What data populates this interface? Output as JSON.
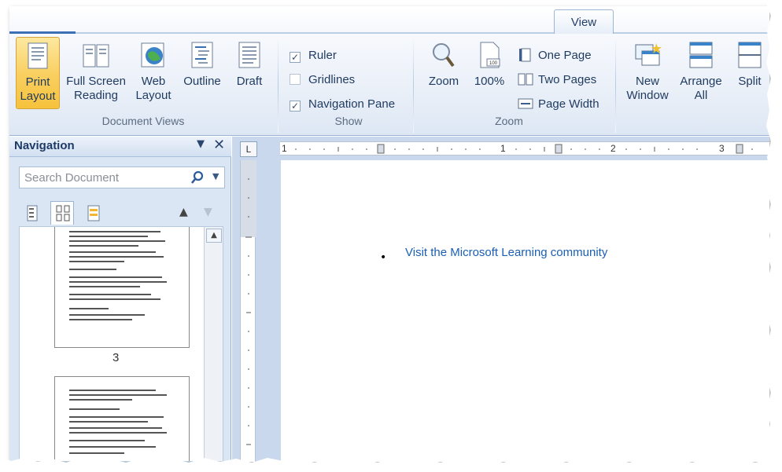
{
  "ribbon": {
    "active_tab": "View",
    "document_views": {
      "label": "Document Views",
      "buttons": [
        {
          "label": "Print\nLayout",
          "line1": "Print",
          "line2": "Layout",
          "active": true
        },
        {
          "label": "Full Screen Reading",
          "line1": "Full Screen",
          "line2": "Reading"
        },
        {
          "label": "Web Layout",
          "line1": "Web",
          "line2": "Layout"
        },
        {
          "label": "Outline",
          "line1": "Outline",
          "line2": ""
        },
        {
          "label": "Draft",
          "line1": "Draft",
          "line2": ""
        }
      ]
    },
    "show": {
      "label": "Show",
      "items": [
        {
          "label": "Ruler",
          "checked": true
        },
        {
          "label": "Gridlines",
          "checked": false
        },
        {
          "label": "Navigation Pane",
          "checked": true
        }
      ]
    },
    "zoom": {
      "label": "Zoom",
      "zoom_button": "Zoom",
      "hundred_button": "100%",
      "one_page": "One Page",
      "two_pages": "Two Pages",
      "page_width": "Page Width"
    },
    "window": {
      "new_window_line1": "New",
      "new_window_line2": "Window",
      "arrange_all_line1": "Arrange",
      "arrange_all_line2": "All",
      "split": "Split"
    }
  },
  "navigation": {
    "title": "Navigation",
    "search_placeholder": "Search Document",
    "current_thumb_page": "3"
  },
  "ruler": {
    "tab_selector": "L",
    "marks": [
      "1",
      "1",
      "2",
      "3"
    ]
  },
  "document": {
    "link_text": "Visit the Microsoft Learning community",
    "bullet": "•"
  },
  "colors": {
    "ribbon_bg": "#e9eff8",
    "active_button": "#f9d062",
    "link": "#1a5fb4"
  }
}
